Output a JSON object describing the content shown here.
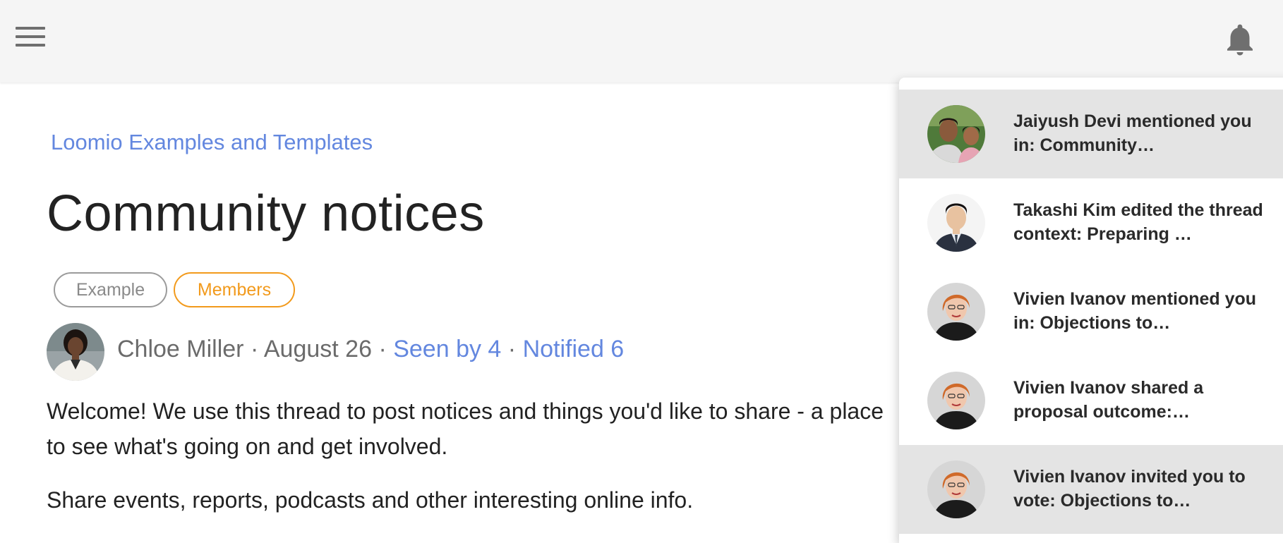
{
  "header": {
    "menu_icon": "hamburger-menu-icon",
    "bell_icon": "notification-bell-icon"
  },
  "thread": {
    "breadcrumb": "Loomio Examples and Templates",
    "title": "Community notices",
    "tags": [
      {
        "label": "Example",
        "color": "#8a8a8a"
      },
      {
        "label": "Members",
        "color": "#f29a1c"
      }
    ],
    "author": "Chloe Miller",
    "separator": "·",
    "date": "August 26",
    "seen_by": "Seen by 4",
    "notified": "Notified 6",
    "body": [
      "Welcome! We use this thread to post notices and things you'd like to share - a place to see what's going on and get involved.",
      "Share events, reports, podcasts and other interesting online info."
    ]
  },
  "notifications": [
    {
      "text": "Jaiyush Devi mentioned you in: Community…",
      "unread": true
    },
    {
      "text": "Takashi Kim edited the thread context: Preparing …",
      "unread": false
    },
    {
      "text": "Vivien Ivanov mentioned you in: Objections to…",
      "unread": false
    },
    {
      "text": "Vivien Ivanov shared a proposal outcome:…",
      "unread": false
    },
    {
      "text": "Vivien Ivanov invited you to vote: Objections to…",
      "unread": true
    }
  ],
  "colors": {
    "link": "#6387df",
    "accent_orange": "#f29a1c",
    "topbar": "#f5f5f5",
    "unread_bg": "#e4e4e4"
  }
}
